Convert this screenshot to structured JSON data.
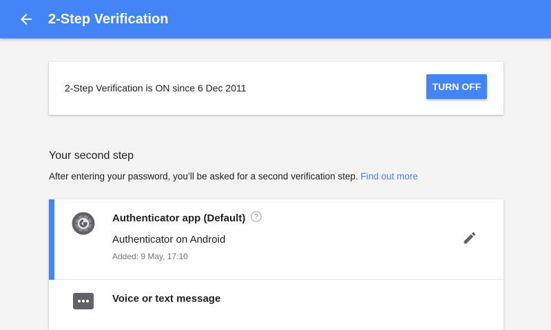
{
  "header": {
    "title": "2-Step Verification",
    "back_icon": "arrow-back-icon",
    "background_color": "#4285f4"
  },
  "status_card": {
    "text": "2-Step Verification is ON since 6 Dec 2011",
    "button_label": "TURN OFF"
  },
  "second_step": {
    "title": "Your second step",
    "description": "After entering your password, you’ll be asked for a second verification step.",
    "link_label": "Find out more"
  },
  "methods": {
    "authenticator": {
      "title": "Authenticator app (Default)",
      "subtitle": "Authenticator on Android",
      "added": "Added: 9 May, 17:10",
      "is_default": true,
      "icon": "google-authenticator-icon",
      "help_icon": "help-outline-icon",
      "edit_icon": "pencil-icon"
    },
    "sms": {
      "title": "Voice or text message",
      "icon": "message-dots-icon"
    }
  },
  "colors": {
    "accent": "#4285f4",
    "text_primary": "#212121",
    "text_secondary": "#757575",
    "page_background": "#f4f4f4"
  }
}
